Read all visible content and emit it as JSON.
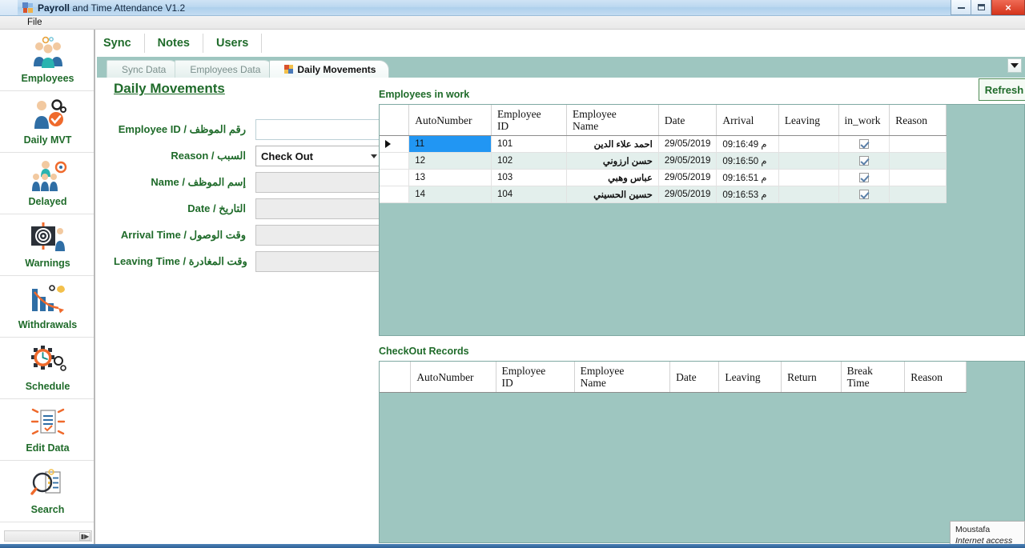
{
  "window": {
    "title_leading": "Payroll",
    "title_rest": " and Time Attendance V1.2",
    "app_icon": "app-grid-icon",
    "minimize": "minimize-icon",
    "maximize": "maximize-icon",
    "close": "×"
  },
  "menubar": {
    "file": "File"
  },
  "sidebar": {
    "items": [
      {
        "label": "Employees",
        "icon": "employees-group-icon"
      },
      {
        "label": "Daily MVT",
        "icon": "person-check-gear-icon"
      },
      {
        "label": "Delayed",
        "icon": "delayed-people-icon"
      },
      {
        "label": "Warnings",
        "icon": "target-board-icon"
      },
      {
        "label": "Withdrawals",
        "icon": "bar-chart-money-icon"
      },
      {
        "label": "Schedule",
        "icon": "clock-gear-icon"
      },
      {
        "label": "Edit Data",
        "icon": "edit-document-icon"
      },
      {
        "label": "Search",
        "icon": "magnifier-list-icon"
      }
    ],
    "scroll_right": "scroll-right-icon"
  },
  "topnav": {
    "items": [
      {
        "label": "Sync"
      },
      {
        "label": "Notes"
      },
      {
        "label": "Users"
      }
    ]
  },
  "tabs": {
    "items": [
      {
        "label": "Sync Data",
        "active": false
      },
      {
        "label": "Employees Data",
        "active": false
      },
      {
        "label": "Daily Movements",
        "active": true,
        "icon": "tab-grid-icon"
      }
    ],
    "overflow_icon": "chevron-down-icon"
  },
  "page": {
    "title": "Daily Movements",
    "refresh_label": "Refresh"
  },
  "form": {
    "fields": [
      {
        "label": "Employee ID / رقم الموظف",
        "value": "",
        "type": "text",
        "name": "employee-id-input",
        "editable": true
      },
      {
        "label": "Reason / السبب",
        "value": "Check Out",
        "type": "select",
        "name": "reason-select"
      },
      {
        "label": "Name / إسم الموظف",
        "value": "",
        "type": "text",
        "name": "name-input",
        "editable": false
      },
      {
        "label": "Date / التاريخ",
        "value": "",
        "type": "text",
        "name": "date-input",
        "editable": false
      },
      {
        "label": "Arrival Time / وقت الوصول",
        "value": "",
        "type": "text",
        "name": "arrival-time-input",
        "editable": false
      },
      {
        "label": "Leaving Time / وقت المغادرة",
        "value": "",
        "type": "text",
        "name": "leaving-time-input",
        "editable": false
      }
    ]
  },
  "grid_in_work": {
    "title": "Employees in work",
    "columns": [
      "AutoNumber",
      "Employee\nID",
      "Employee\nName",
      "Date",
      "Arrival",
      "Leaving",
      "in_work",
      "Reason"
    ],
    "rows": [
      {
        "autonumber": "11",
        "employee_id": "101",
        "employee_name": "احمد علاء الدين",
        "date": "29/05/2019",
        "arrival": "09:16:49 م",
        "leaving": "",
        "in_work": true,
        "reason": "",
        "selected": true
      },
      {
        "autonumber": "12",
        "employee_id": "102",
        "employee_name": "حسن ارزوني",
        "date": "29/05/2019",
        "arrival": "09:16:50 م",
        "leaving": "",
        "in_work": true,
        "reason": "",
        "selected": false
      },
      {
        "autonumber": "13",
        "employee_id": "103",
        "employee_name": "عباس وهبي",
        "date": "29/05/2019",
        "arrival": "09:16:51 م",
        "leaving": "",
        "in_work": true,
        "reason": "",
        "selected": false
      },
      {
        "autonumber": "14",
        "employee_id": "104",
        "employee_name": "حسين الحسيني",
        "date": "29/05/2019",
        "arrival": "09:16:53 م",
        "leaving": "",
        "in_work": true,
        "reason": "",
        "selected": false
      }
    ]
  },
  "grid_checkout": {
    "title": "CheckOut Records",
    "columns": [
      "AutoNumber",
      "Employee\nID",
      "Employee\nName",
      "Date",
      "Leaving",
      "Return",
      "Break\nTime",
      "Reason"
    ],
    "rows": []
  },
  "network_tooltip": {
    "line1": "Moustafa",
    "line2": "Internet access"
  },
  "colors": {
    "teal_panel": "#9ec6c0",
    "green_text": "#1f6b2a",
    "row_alt": "#e3efec",
    "selection_blue": "#2196f3"
  }
}
